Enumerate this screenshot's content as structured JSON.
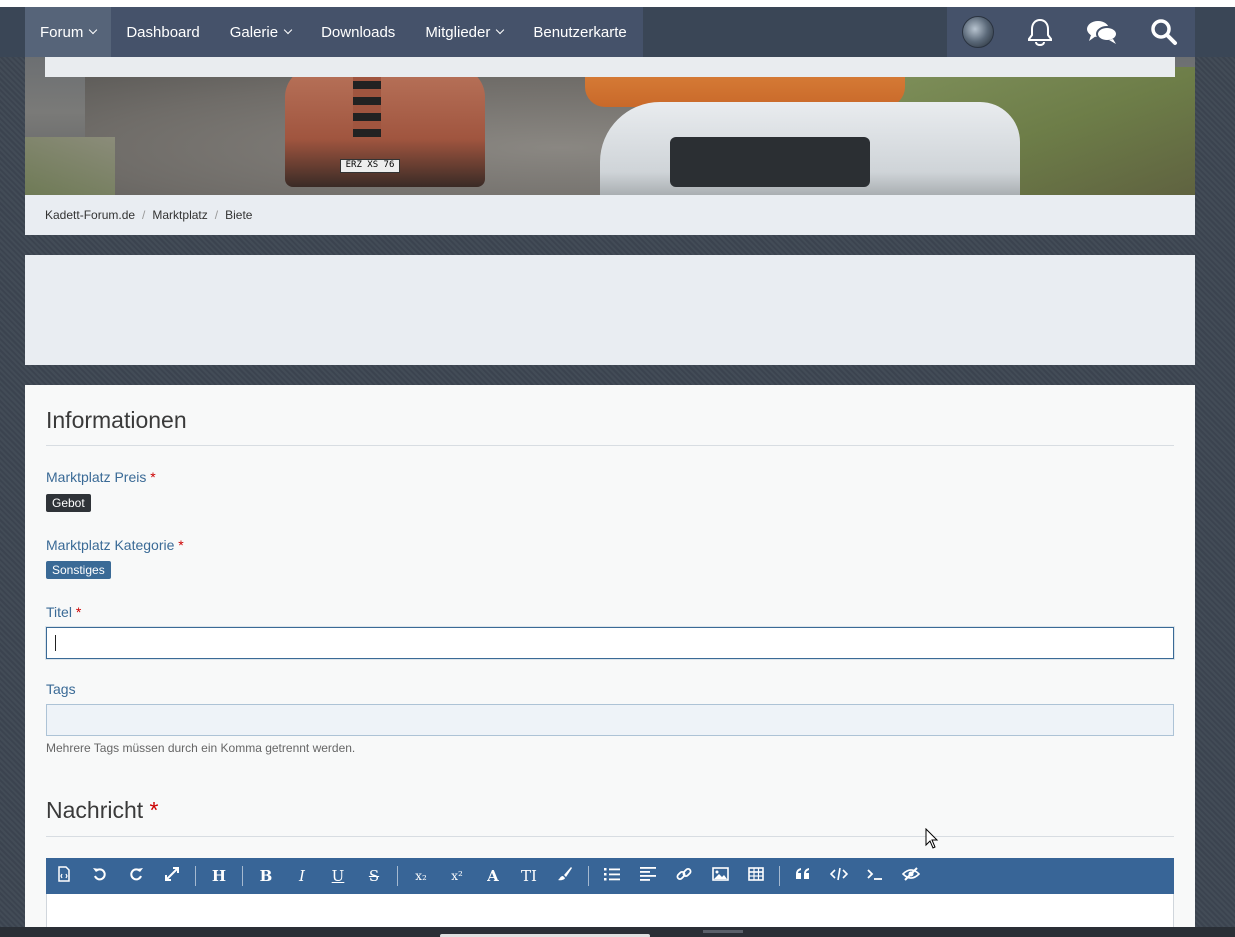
{
  "nav": {
    "items": [
      {
        "label": "Forum",
        "dropdown": true,
        "active": true
      },
      {
        "label": "Dashboard",
        "dropdown": false
      },
      {
        "label": "Galerie",
        "dropdown": true
      },
      {
        "label": "Downloads",
        "dropdown": false
      },
      {
        "label": "Mitglieder",
        "dropdown": true
      },
      {
        "label": "Benutzerkarte",
        "dropdown": false
      }
    ],
    "right_icons": [
      "user-avatar",
      "bell-icon",
      "chat-bubbles-icon",
      "search-icon"
    ]
  },
  "banner": {
    "plate_text": "ERZ XS 76"
  },
  "breadcrumb": {
    "items": [
      "Kadett-Forum.de",
      "Marktplatz",
      "Biete"
    ],
    "separator": "/"
  },
  "form": {
    "section_title": "Informationen",
    "price": {
      "label": "Marktplatz Preis",
      "required": "*",
      "value": "Gebot"
    },
    "category": {
      "label": "Marktplatz Kategorie",
      "required": "*",
      "value": "Sonstiges"
    },
    "title": {
      "label": "Titel",
      "required": "*",
      "value": ""
    },
    "tags": {
      "label": "Tags",
      "value": "",
      "hint": "Mehrere Tags müssen durch ein Komma getrennt werden."
    },
    "message": {
      "label": "Nachricht",
      "required": "*"
    }
  },
  "editor": {
    "toolbar_icons": [
      "source-icon",
      "undo-icon",
      "redo-icon",
      "fullscreen-icon",
      "|",
      "heading-icon",
      "|",
      "bold-icon",
      "italic-icon",
      "underline-icon",
      "strikethrough-icon",
      "|",
      "subscript-icon",
      "superscript-icon",
      "font-icon",
      "font-size-icon",
      "color-brush-icon",
      "|",
      "list-icon",
      "align-icon",
      "link-icon",
      "image-icon",
      "table-icon",
      "|",
      "quote-icon",
      "code-icon",
      "inline-code-icon",
      "spoiler-icon"
    ],
    "toolbar_glyphs": {
      "heading-icon": "H",
      "bold-icon": "B",
      "italic-icon": "I",
      "underline-icon": "U",
      "strikethrough-icon": "S",
      "subscript-icon": "x₂",
      "superscript-icon": "x²",
      "font-icon": "A",
      "font-size-icon": "TI"
    }
  },
  "colors": {
    "nav_bg": "#45526a",
    "accent": "#3a6a96",
    "required": "#cc0000",
    "toolbar_bg": "#386597"
  }
}
